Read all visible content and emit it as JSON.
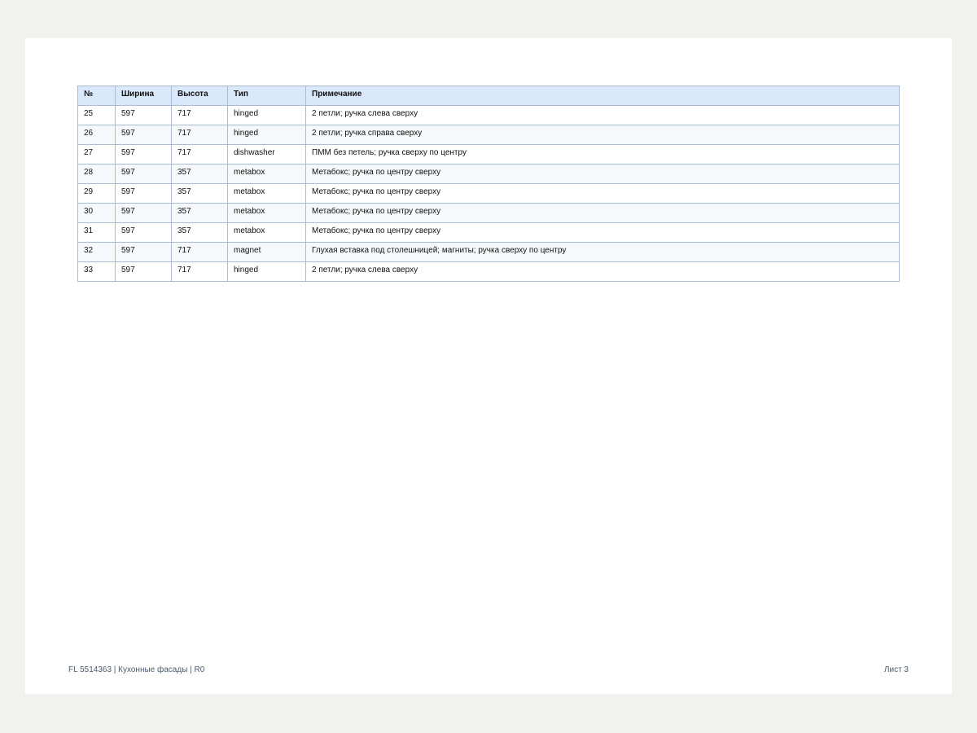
{
  "table": {
    "headers": [
      "№",
      "Ширина",
      "Высота",
      "Тип",
      "Примечание"
    ],
    "rows": [
      [
        "25",
        "597",
        "717",
        "hinged",
        "2 петли; ручка слева сверху"
      ],
      [
        "26",
        "597",
        "717",
        "hinged",
        "2 петли; ручка справа сверху"
      ],
      [
        "27",
        "597",
        "717",
        "dishwasher",
        "ПММ без петель; ручка сверху по центру"
      ],
      [
        "28",
        "597",
        "357",
        "metabox",
        "Метабокс; ручка по центру сверху"
      ],
      [
        "29",
        "597",
        "357",
        "metabox",
        "Метабокс; ручка по центру сверху"
      ],
      [
        "30",
        "597",
        "357",
        "metabox",
        "Метабокс; ручка по центру сверху"
      ],
      [
        "31",
        "597",
        "357",
        "metabox",
        "Метабокс; ручка по центру сверху"
      ],
      [
        "32",
        "597",
        "717",
        "magnet",
        "Глухая вставка под столешницей; магниты; ручка сверху по центру"
      ],
      [
        "33",
        "597",
        "717",
        "hinged",
        "2 петли; ручка слева сверху"
      ]
    ]
  },
  "footer": {
    "left": "FL 5514363 | Кухонные фасады | R0",
    "right": "Лист 3"
  },
  "colors": {
    "header_bg": "#dae8fc",
    "border": "#a9bed6",
    "page_bg": "#ffffff",
    "canvas_bg": "#f1f1ef"
  }
}
